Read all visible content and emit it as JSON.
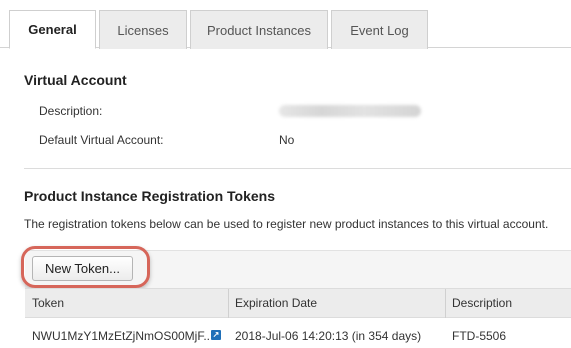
{
  "tabs": [
    {
      "label": "General",
      "active": true
    },
    {
      "label": "Licenses",
      "active": false
    },
    {
      "label": "Product Instances",
      "active": false
    },
    {
      "label": "Event Log",
      "active": false
    }
  ],
  "virtual_account": {
    "heading": "Virtual Account",
    "description_label": "Description:",
    "default_label": "Default Virtual Account:",
    "default_value": "No"
  },
  "tokens": {
    "heading": "Product Instance Registration Tokens",
    "intro": "The registration tokens below can be used to register new product instances to this virtual account.",
    "new_token_label": "New Token...",
    "columns": [
      "Token",
      "Expiration Date",
      "Description"
    ],
    "rows": [
      {
        "token": "NWU1MzY1MzEtZjNmOS00MjF..",
        "expiration": "2018-Jul-06 14:20:13 (in 354 days)",
        "description": "FTD-5506"
      }
    ]
  },
  "colors": {
    "highlight": "#d6665a",
    "link_icon": "#1f6fb8"
  },
  "icons": {
    "token_link": "external-link-icon"
  }
}
